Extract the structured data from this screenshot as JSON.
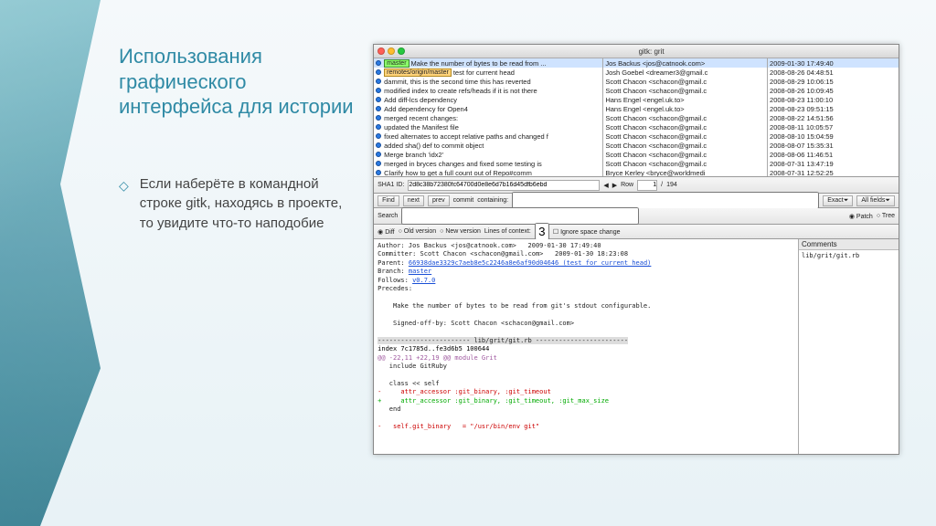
{
  "slide": {
    "heading": "Использования графического интерфейса для истории",
    "bullet": "Если наберёте в командной строке gitk, находясь в проекте, то увидите что-то наподобие"
  },
  "window": {
    "title": "gitk: grit",
    "commits": [
      {
        "tag": "master",
        "msg": "Make the number of bytes to be read from ...",
        "sel": true
      },
      {
        "remote": "remotes/origin/master",
        "msg": "test for current head"
      },
      {
        "msg": "dammit, this is the second time this has reverted"
      },
      {
        "msg": "modified index to create refs/heads if it is not there"
      },
      {
        "msg": "Add diff-lcs dependency"
      },
      {
        "msg": "Add dependency for Open4"
      },
      {
        "msg": "merged recent changes:"
      },
      {
        "msg": "updated the Manifest file"
      },
      {
        "msg": "fixed alternates to accept relative paths and changed f"
      },
      {
        "msg": "added sha() def to commit object"
      },
      {
        "msg": "Merge branch 'idx2'"
      },
      {
        "msg": "merged in bryces changes and fixed some testing is"
      },
      {
        "msg": "Clarify how to get a full count out of Repo#comm"
      }
    ],
    "authors": [
      "Jos Backus <jos@catnook.com>",
      "Josh Goebel <dreamer3@gmail.c",
      "Scott Chacon <schacon@gmail.c",
      "Scott Chacon <schacon@gmail.c",
      "Hans Engel <engel.uk.to>",
      "Hans Engel <engel.uk.to>",
      "Scott Chacon <schacon@gmail.c",
      "Scott Chacon <schacon@gmail.c",
      "Scott Chacon <schacon@gmail.c",
      "Scott Chacon <schacon@gmail.c",
      "Scott Chacon <schacon@gmail.c",
      "Scott Chacon <schacon@gmail.c",
      "Bryce Kerley <bryce@worldmedi"
    ],
    "dates": [
      "2009-01-30 17:49:40",
      "2008-08-26 04:48:51",
      "2008-08-29 10:06:15",
      "2008-08-26 10:09:45",
      "2008-08-23 11:00:10",
      "2008-08-23 09:51:15",
      "2008-08-22 14:51:56",
      "2008-08-11 10:05:57",
      "2008-08-10 15:04:59",
      "2008-08-07 15:35:31",
      "2008-08-06 11:46:51",
      "2008-07-31 13:47:19",
      "2008-07-31 12:52:25"
    ],
    "sha_label": "SHA1 ID:",
    "sha_value": "2d8c38b72380fc64700d0e8e6d7b16d45dfb6ebd",
    "row_label": "Row",
    "row_cur": "1",
    "row_sep": "/",
    "row_tot": "194",
    "find": {
      "find": "Find",
      "next": "next",
      "prev": "prev",
      "commit": "commit",
      "containing": "containing:",
      "exact": "Exact",
      "allfields": "All fields"
    },
    "search": {
      "label": "Search",
      "diff_radio": "Diff",
      "old_radio": "Old version",
      "new_radio": "New version",
      "lines_label": "Lines of context:",
      "lines_val": "3",
      "ignorespace": "Ignore space change",
      "patch_radio": "Patch",
      "tree_radio": "Tree"
    },
    "detail": {
      "author_lbl": "Author:",
      "author_val": "Jos Backus <jos@catnook.com>   2009-01-30 17:49:40",
      "committer_lbl": "Committer:",
      "committer_val": "Scott Chacon <schacon@gmail.com>   2009-01-30 18:23:08",
      "parent_lbl": "Parent:",
      "parent_val": "66938dae3329c7aeb8e5c2246a8e6af90d04646 (test for current head)",
      "branch_lbl": "Branch:",
      "branch_val": "master",
      "follows_lbl": "Follows:",
      "follows_val": "v0.7.0",
      "precedes_lbl": "Precedes:",
      "commit_msg1": "Make the number of bytes to be read from git's stdout configurable.",
      "commit_msg2": "Signed-off-by: Scott Chacon <schacon@gmail.com>",
      "diff_file_hdr": "------------------------ lib/grit/git.rb ------------------------",
      "diff_index": "index 7c1785d..fe3d6b5 100644",
      "diff_hunk": "@@ -22,11 +22,19 @@ module Grit",
      "diff_l1": "   include GitRuby",
      "diff_l2": "   class << self",
      "diff_del": "-     attr_accessor :git_binary, :git_timeout",
      "diff_add": "+     attr_accessor :git_binary, :git_timeout, :git_max_size",
      "diff_l3": "   end",
      "diff_del2": "-   self.git_binary   = \"/usr/bin/env git\""
    },
    "sidebar": {
      "header": "Comments",
      "file": "lib/grit/git.rb"
    }
  }
}
